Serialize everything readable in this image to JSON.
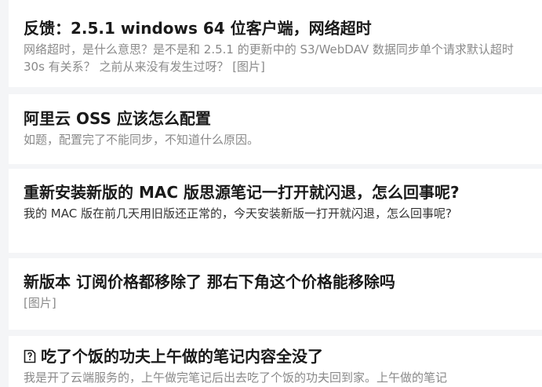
{
  "feed": {
    "items": [
      {
        "title": "反馈：2.5.1 windows 64 位客户端，网络超时",
        "excerpt": "网络超时，是什么意思？是不是和 2.5.1 的更新中的 S3/WebDAV 数据同步单个请求默认超时 30s 有关系？ 之前从来没有发生过呀？ [图片]"
      },
      {
        "title": "阿里云 OSS 应该怎么配置",
        "excerpt": "如题，配置完了不能同步，不知道什么原因。"
      },
      {
        "title": "重新安装新版的 MAC 版思源笔记一打开就闪退，怎么回事呢?",
        "excerpt": "我的 MAC 版在前几天用旧版还正常的，今天安装新版一打开就闪退，怎么回事呢?"
      },
      {
        "title": "新版本 订阅价格都移除了 那右下角这个价格能移除吗",
        "excerpt": "[图片]"
      },
      {
        "icon": "question-note-icon",
        "title": "吃了个饭的功夫上午做的笔记内容全没了",
        "excerpt": "我是开了云端服务的，上午做完笔记后出去吃了个饭的功夫回到家。上午做的笔记"
      }
    ]
  }
}
